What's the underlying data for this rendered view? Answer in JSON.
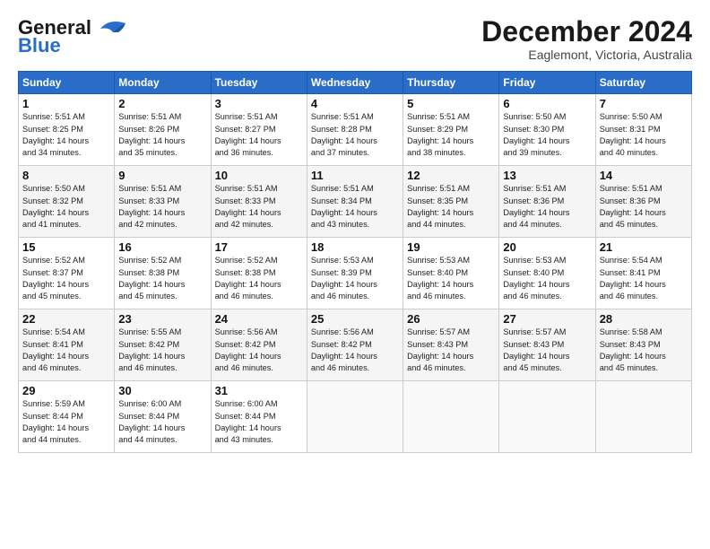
{
  "logo": {
    "line1": "General",
    "line2": "Blue"
  },
  "title": "December 2024",
  "subtitle": "Eaglemont, Victoria, Australia",
  "weekdays": [
    "Sunday",
    "Monday",
    "Tuesday",
    "Wednesday",
    "Thursday",
    "Friday",
    "Saturday"
  ],
  "weeks": [
    [
      {
        "day": "1",
        "info": "Sunrise: 5:51 AM\nSunset: 8:25 PM\nDaylight: 14 hours\nand 34 minutes."
      },
      {
        "day": "2",
        "info": "Sunrise: 5:51 AM\nSunset: 8:26 PM\nDaylight: 14 hours\nand 35 minutes."
      },
      {
        "day": "3",
        "info": "Sunrise: 5:51 AM\nSunset: 8:27 PM\nDaylight: 14 hours\nand 36 minutes."
      },
      {
        "day": "4",
        "info": "Sunrise: 5:51 AM\nSunset: 8:28 PM\nDaylight: 14 hours\nand 37 minutes."
      },
      {
        "day": "5",
        "info": "Sunrise: 5:51 AM\nSunset: 8:29 PM\nDaylight: 14 hours\nand 38 minutes."
      },
      {
        "day": "6",
        "info": "Sunrise: 5:50 AM\nSunset: 8:30 PM\nDaylight: 14 hours\nand 39 minutes."
      },
      {
        "day": "7",
        "info": "Sunrise: 5:50 AM\nSunset: 8:31 PM\nDaylight: 14 hours\nand 40 minutes."
      }
    ],
    [
      {
        "day": "8",
        "info": "Sunrise: 5:50 AM\nSunset: 8:32 PM\nDaylight: 14 hours\nand 41 minutes."
      },
      {
        "day": "9",
        "info": "Sunrise: 5:51 AM\nSunset: 8:33 PM\nDaylight: 14 hours\nand 42 minutes."
      },
      {
        "day": "10",
        "info": "Sunrise: 5:51 AM\nSunset: 8:33 PM\nDaylight: 14 hours\nand 42 minutes."
      },
      {
        "day": "11",
        "info": "Sunrise: 5:51 AM\nSunset: 8:34 PM\nDaylight: 14 hours\nand 43 minutes."
      },
      {
        "day": "12",
        "info": "Sunrise: 5:51 AM\nSunset: 8:35 PM\nDaylight: 14 hours\nand 44 minutes."
      },
      {
        "day": "13",
        "info": "Sunrise: 5:51 AM\nSunset: 8:36 PM\nDaylight: 14 hours\nand 44 minutes."
      },
      {
        "day": "14",
        "info": "Sunrise: 5:51 AM\nSunset: 8:36 PM\nDaylight: 14 hours\nand 45 minutes."
      }
    ],
    [
      {
        "day": "15",
        "info": "Sunrise: 5:52 AM\nSunset: 8:37 PM\nDaylight: 14 hours\nand 45 minutes."
      },
      {
        "day": "16",
        "info": "Sunrise: 5:52 AM\nSunset: 8:38 PM\nDaylight: 14 hours\nand 45 minutes."
      },
      {
        "day": "17",
        "info": "Sunrise: 5:52 AM\nSunset: 8:38 PM\nDaylight: 14 hours\nand 46 minutes."
      },
      {
        "day": "18",
        "info": "Sunrise: 5:53 AM\nSunset: 8:39 PM\nDaylight: 14 hours\nand 46 minutes."
      },
      {
        "day": "19",
        "info": "Sunrise: 5:53 AM\nSunset: 8:40 PM\nDaylight: 14 hours\nand 46 minutes."
      },
      {
        "day": "20",
        "info": "Sunrise: 5:53 AM\nSunset: 8:40 PM\nDaylight: 14 hours\nand 46 minutes."
      },
      {
        "day": "21",
        "info": "Sunrise: 5:54 AM\nSunset: 8:41 PM\nDaylight: 14 hours\nand 46 minutes."
      }
    ],
    [
      {
        "day": "22",
        "info": "Sunrise: 5:54 AM\nSunset: 8:41 PM\nDaylight: 14 hours\nand 46 minutes."
      },
      {
        "day": "23",
        "info": "Sunrise: 5:55 AM\nSunset: 8:42 PM\nDaylight: 14 hours\nand 46 minutes."
      },
      {
        "day": "24",
        "info": "Sunrise: 5:56 AM\nSunset: 8:42 PM\nDaylight: 14 hours\nand 46 minutes."
      },
      {
        "day": "25",
        "info": "Sunrise: 5:56 AM\nSunset: 8:42 PM\nDaylight: 14 hours\nand 46 minutes."
      },
      {
        "day": "26",
        "info": "Sunrise: 5:57 AM\nSunset: 8:43 PM\nDaylight: 14 hours\nand 46 minutes."
      },
      {
        "day": "27",
        "info": "Sunrise: 5:57 AM\nSunset: 8:43 PM\nDaylight: 14 hours\nand 45 minutes."
      },
      {
        "day": "28",
        "info": "Sunrise: 5:58 AM\nSunset: 8:43 PM\nDaylight: 14 hours\nand 45 minutes."
      }
    ],
    [
      {
        "day": "29",
        "info": "Sunrise: 5:59 AM\nSunset: 8:44 PM\nDaylight: 14 hours\nand 44 minutes."
      },
      {
        "day": "30",
        "info": "Sunrise: 6:00 AM\nSunset: 8:44 PM\nDaylight: 14 hours\nand 44 minutes."
      },
      {
        "day": "31",
        "info": "Sunrise: 6:00 AM\nSunset: 8:44 PM\nDaylight: 14 hours\nand 43 minutes."
      },
      {
        "day": "",
        "info": ""
      },
      {
        "day": "",
        "info": ""
      },
      {
        "day": "",
        "info": ""
      },
      {
        "day": "",
        "info": ""
      }
    ]
  ]
}
